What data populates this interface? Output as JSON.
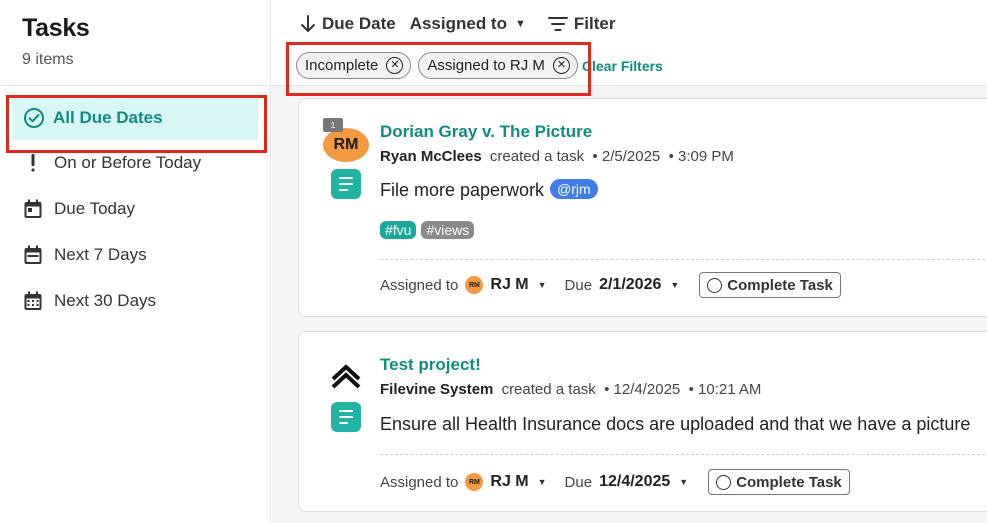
{
  "sidebar": {
    "title": "Tasks",
    "subtitle": "9 items",
    "items": [
      {
        "label": "All Due Dates",
        "icon": "check-circle-icon"
      },
      {
        "label": "On or Before Today",
        "icon": "exclamation-icon"
      },
      {
        "label": "Due Today",
        "icon": "calendar-day-icon"
      },
      {
        "label": "Next 7 Days",
        "icon": "calendar-week-icon"
      },
      {
        "label": "Next 30 Days",
        "icon": "calendar-month-icon"
      }
    ]
  },
  "toolbar": {
    "sort_label": "Due Date",
    "assigned_label": "Assigned to",
    "filter_label": "Filter",
    "chips": [
      "Incomplete",
      "Assigned to RJ M"
    ],
    "clear_label": "Clear Filters"
  },
  "tasks": [
    {
      "project": "Dorian Gray v. The Picture",
      "avatar_initials": "RM",
      "badge_count": "1",
      "author": "Ryan McClees",
      "action": "created a task",
      "date": "2/5/2025",
      "time": "3:09 PM",
      "description": "File more paperwork",
      "mention": "@rjm",
      "tags": [
        {
          "label": "#fvu",
          "color": "#1ba79a"
        },
        {
          "label": "#views",
          "color": "#8a8a8a"
        }
      ],
      "assigned_label": "Assigned to",
      "assignee_initials": "RM",
      "assignee": "RJ M",
      "due_label": "Due",
      "due_date": "2/1/2026",
      "complete_label": "Complete Task"
    },
    {
      "project": "Test project!",
      "author": "Filevine System",
      "action": "created a task",
      "date": "12/4/2025",
      "time": "10:21 AM",
      "description": "Ensure all Health Insurance docs are uploaded and that we have a picture",
      "assigned_label": "Assigned to",
      "assignee_initials": "RM",
      "assignee": "RJ M",
      "due_label": "Due",
      "due_date": "12/4/2025",
      "complete_label": "Complete Task"
    }
  ],
  "colors": {
    "accent": "#0f8c80",
    "highlight": "#e0281c",
    "active_bg": "#d6f7f3",
    "avatar": "#f39a41"
  }
}
